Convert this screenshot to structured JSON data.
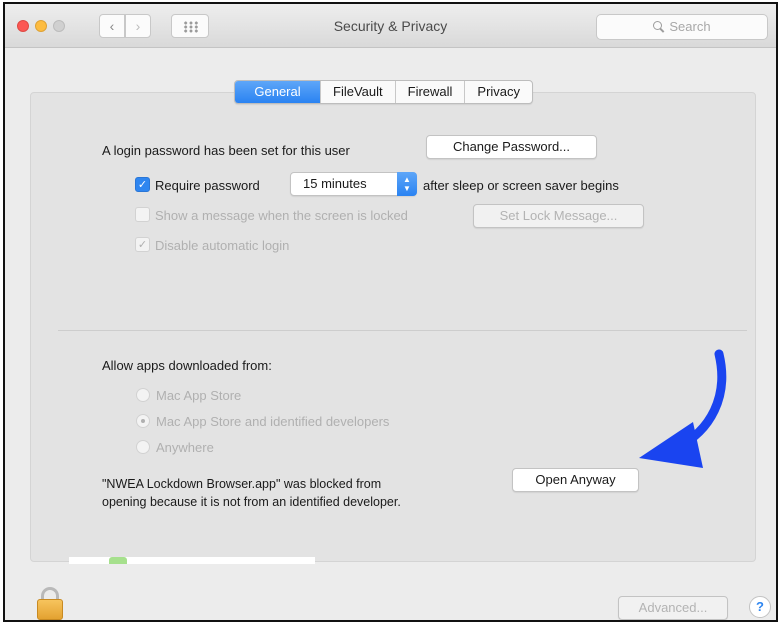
{
  "window": {
    "title": "Security & Privacy",
    "search_placeholder": "Search",
    "nav_back": "‹",
    "nav_forward": "›"
  },
  "tabs": [
    {
      "label": "General",
      "active": true
    },
    {
      "label": "FileVault",
      "active": false
    },
    {
      "label": "Firewall",
      "active": false
    },
    {
      "label": "Privacy",
      "active": false
    }
  ],
  "login": {
    "text": "A login password has been set for this user",
    "change_password_button": "Change Password...",
    "require_password_label": "Require password",
    "require_password_checked": true,
    "require_password_delay": "15 minutes",
    "require_password_suffix": "after sleep or screen saver begins",
    "show_message_label": "Show a message when the screen is locked",
    "show_message_checked": false,
    "set_lock_message_button": "Set Lock Message...",
    "disable_auto_login_label": "Disable automatic login",
    "disable_auto_login_checked": true
  },
  "apps": {
    "heading": "Allow apps downloaded from:",
    "options": [
      {
        "label": "Mac App Store",
        "selected": false
      },
      {
        "label": "Mac App Store and identified developers",
        "selected": true
      },
      {
        "label": "Anywhere",
        "selected": false
      }
    ],
    "blocked_line1": "\"NWEA Lockdown Browser.app\" was blocked from",
    "blocked_line2": "opening because it is not from an identified developer.",
    "open_anyway_button": "Open Anyway"
  },
  "footer": {
    "advanced_button": "Advanced...",
    "help_label": "?"
  },
  "colors": {
    "accent": "#2a83f2",
    "annotation_arrow": "#1a44f0"
  }
}
